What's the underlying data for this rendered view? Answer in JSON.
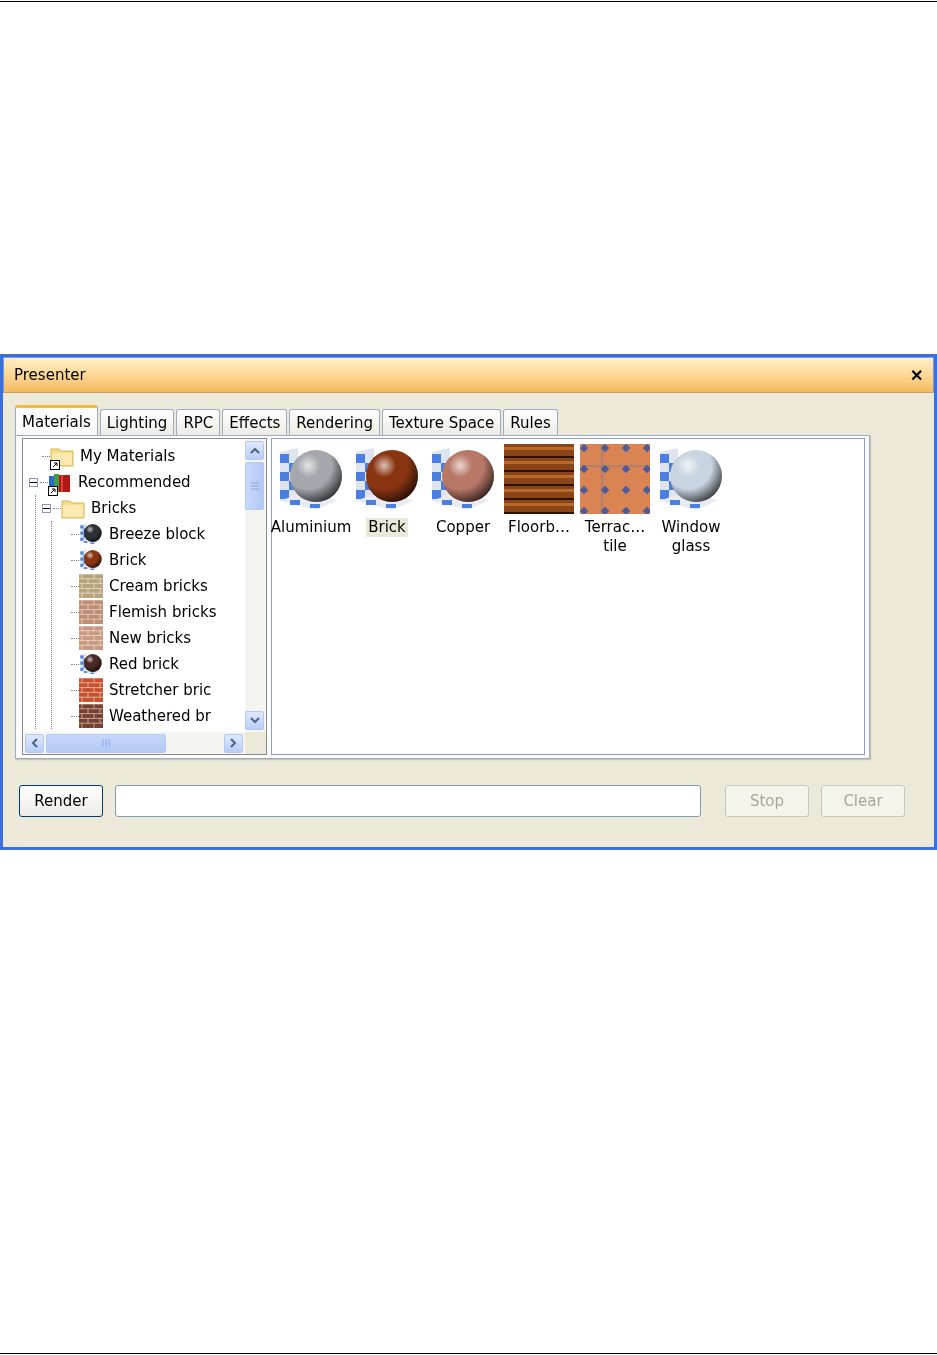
{
  "window": {
    "title": "Presenter",
    "close": "✕"
  },
  "tabs": [
    {
      "label": "Materials",
      "selected": true
    },
    {
      "label": "Lighting",
      "selected": false
    },
    {
      "label": "RPC",
      "selected": false
    },
    {
      "label": "Effects",
      "selected": false
    },
    {
      "label": "Rendering",
      "selected": false
    },
    {
      "label": "Texture Space",
      "selected": false
    },
    {
      "label": "Rules",
      "selected": false
    }
  ],
  "tree": [
    {
      "label": "My Materials",
      "kind": "folder",
      "shortcut": true
    },
    {
      "label": "Recommended",
      "kind": "books",
      "shortcut": true,
      "expanded": true,
      "children": [
        {
          "label": "Bricks",
          "kind": "folder",
          "expanded": true,
          "children": [
            {
              "label": "Breeze block",
              "kind": "sphere",
              "color": "#2e3236"
            },
            {
              "label": "Brick",
              "kind": "sphere",
              "color": "#8a3512"
            },
            {
              "label": "Cream bricks",
              "kind": "bricks",
              "color": "#b8a47a"
            },
            {
              "label": "Flemish bricks",
              "kind": "bricks",
              "color": "#c08c74"
            },
            {
              "label": "New bricks",
              "kind": "bricks",
              "color": "#c99a80"
            },
            {
              "label": "Red brick",
              "kind": "sphere",
              "color": "#4a2a22"
            },
            {
              "label": "Stretcher bric",
              "kind": "bricks",
              "color": "#c8522e"
            },
            {
              "label": "Weathered br",
              "kind": "bricks",
              "color": "#7a4030"
            }
          ]
        }
      ]
    }
  ],
  "materials": [
    {
      "label": "Aluminium",
      "kind": "sphere",
      "color": "#a4a8ac",
      "selected": false
    },
    {
      "label": "Brick",
      "kind": "sphere",
      "color": "#8a3512",
      "selected": true
    },
    {
      "label": "Copper",
      "kind": "sphere",
      "color": "#b87868",
      "selected": false
    },
    {
      "label": "Floorb…",
      "kind": "planks",
      "color": "#8a4416",
      "selected": false
    },
    {
      "label": "Terrac… tile",
      "kind": "tile",
      "color": "#d98452",
      "selected": false
    },
    {
      "label": "Window glass",
      "kind": "glass",
      "color": "#c8d4e0",
      "selected": false
    }
  ],
  "buttons": [
    {
      "label": "Render",
      "disabled": false
    },
    {
      "label": "Stop",
      "disabled": true
    },
    {
      "label": "Clear",
      "disabled": true
    }
  ]
}
